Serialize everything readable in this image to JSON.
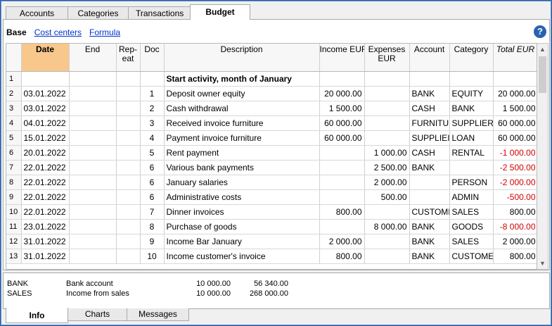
{
  "tabs": [
    "Accounts",
    "Categories",
    "Transactions",
    "Budget"
  ],
  "active_tab": "Budget",
  "views": {
    "base": "Base",
    "cost_centers": "Cost centers",
    "formula": "Formula"
  },
  "help_icon": "?",
  "columns": [
    {
      "key": "date",
      "label": "Date"
    },
    {
      "key": "end",
      "label": "End"
    },
    {
      "key": "repeat",
      "label": "Rep-\neat"
    },
    {
      "key": "doc",
      "label": "Doc"
    },
    {
      "key": "description",
      "label": "Description"
    },
    {
      "key": "income",
      "label": "Income EUR"
    },
    {
      "key": "expenses",
      "label": "Expenses\nEUR"
    },
    {
      "key": "account",
      "label": "Account"
    },
    {
      "key": "category",
      "label": "Category"
    },
    {
      "key": "total",
      "label": "Total EUR"
    }
  ],
  "rows": [
    {
      "n": "1",
      "date": "",
      "end": "",
      "repeat": "",
      "doc": "",
      "description": "Start activity, month of January",
      "income": "",
      "expenses": "",
      "account": "",
      "category": "",
      "total": ""
    },
    {
      "n": "2",
      "date": "03.01.2022",
      "end": "",
      "repeat": "",
      "doc": "1",
      "description": "Deposit owner equity",
      "income": "20 000.00",
      "expenses": "",
      "account": "BANK",
      "category": "EQUITY",
      "total": "20 000.00"
    },
    {
      "n": "3",
      "date": "03.01.2022",
      "end": "",
      "repeat": "",
      "doc": "2",
      "description": "Cash withdrawal",
      "income": "1 500.00",
      "expenses": "",
      "account": "CASH",
      "category": "BANK",
      "total": "1 500.00"
    },
    {
      "n": "4",
      "date": "04.01.2022",
      "end": "",
      "repeat": "",
      "doc": "3",
      "description": "Received invoice furniture",
      "income": "60 000.00",
      "expenses": "",
      "account": "FURNITU",
      "category": "SUPPLIER",
      "total": "60 000.00"
    },
    {
      "n": "5",
      "date": "15.01.2022",
      "end": "",
      "repeat": "",
      "doc": "4",
      "description": "Payment invoice furniture",
      "income": "60 000.00",
      "expenses": "",
      "account": "SUPPLIEI",
      "category": "LOAN",
      "total": "60 000.00"
    },
    {
      "n": "6",
      "date": "20.01.2022",
      "end": "",
      "repeat": "",
      "doc": "5",
      "description": "Rent payment",
      "income": "",
      "expenses": "1 000.00",
      "account": "CASH",
      "category": "RENTAL",
      "total": "-1 000.00"
    },
    {
      "n": "7",
      "date": "22.01.2022",
      "end": "",
      "repeat": "",
      "doc": "6",
      "description": "Various bank payments",
      "income": "",
      "expenses": "2 500.00",
      "account": "BANK",
      "category": "",
      "total": "-2 500.00"
    },
    {
      "n": "8",
      "date": "22.01.2022",
      "end": "",
      "repeat": "",
      "doc": "6",
      "description": "January salaries",
      "income": "",
      "expenses": "2 000.00",
      "account": "",
      "category": "PERSON",
      "total": "-2 000.00"
    },
    {
      "n": "9",
      "date": "22.01.2022",
      "end": "",
      "repeat": "",
      "doc": "6",
      "description": "Administrative costs",
      "income": "",
      "expenses": "500.00",
      "account": "",
      "category": "ADMIN",
      "total": "-500.00"
    },
    {
      "n": "10",
      "date": "22.01.2022",
      "end": "",
      "repeat": "",
      "doc": "7",
      "description": "Dinner invoices",
      "income": "800.00",
      "expenses": "",
      "account": "CUSTOMI",
      "category": "SALES",
      "total": "800.00"
    },
    {
      "n": "11",
      "date": "23.01.2022",
      "end": "",
      "repeat": "",
      "doc": "8",
      "description": "Purchase of goods",
      "income": "",
      "expenses": "8 000.00",
      "account": "BANK",
      "category": "GOODS",
      "total": "-8 000.00"
    },
    {
      "n": "12",
      "date": "31.01.2022",
      "end": "",
      "repeat": "",
      "doc": "9",
      "description": "Income Bar January",
      "income": "2 000.00",
      "expenses": "",
      "account": "BANK",
      "category": "SALES",
      "total": "2 000.00"
    },
    {
      "n": "13",
      "date": "31.01.2022",
      "end": "",
      "repeat": "",
      "doc": "10",
      "description": "Income customer's invoice",
      "income": "800.00",
      "expenses": "",
      "account": "BANK",
      "category": "CUSTOME",
      "total": "800.00"
    }
  ],
  "info": [
    {
      "code": "BANK",
      "name": "Bank account",
      "v1": "10 000.00",
      "v2": "56 340.00"
    },
    {
      "code": "SALES",
      "name": "Income from sales",
      "v1": "10 000.00",
      "v2": "268 000.00"
    }
  ],
  "bottom_tabs": [
    "Info",
    "Charts",
    "Messages"
  ],
  "active_bottom_tab": "Info",
  "colors": {
    "selected_header": "#f7c78b",
    "negative": "#d00000",
    "link": "#0033cc",
    "help": "#2a62b0"
  }
}
